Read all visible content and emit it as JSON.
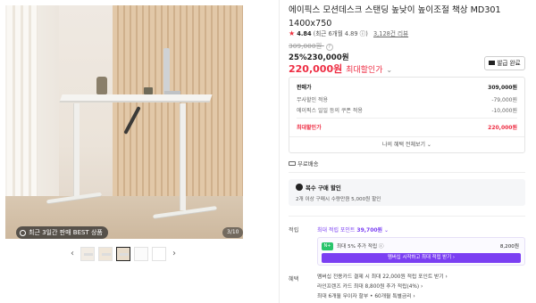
{
  "image": {
    "best_badge": "최근 3일간 판매 BEST 상품",
    "counter": "3/10",
    "prev_arrow": "‹",
    "next_arrow": "›",
    "thumbnail_count": 6,
    "selected_thumbnail": 3
  },
  "product": {
    "title": "에이픽스 모션데스크 스탠딩 높낮이 높이조절 책상 MD301 1400x750",
    "rating": {
      "star": "★",
      "score": "4.84",
      "count_text": "(최근 6개월 4.89 ⓘ)",
      "reviews": "3,128건 리뷰"
    },
    "original_price": "309,000원",
    "original_price_info": "?",
    "sale_price_line": "25%230,000원",
    "max_discount_price": "220,000원",
    "max_discount_label": "최대할인가",
    "max_discount_chevron": "⌄",
    "coupon_button": "발급 완료"
  },
  "price_box": {
    "rows": [
      {
        "label": "판매가",
        "value": "309,000원"
      },
      {
        "label": "무사할인 적용",
        "value": "-79,000원"
      },
      {
        "label": "에이픽스 일일 등의 쿠폰 적용",
        "value": "-10,000원"
      }
    ],
    "total_label": "최대할인가",
    "total_value": "220,000원",
    "all_benefits": "나의 혜택 전체보기 ⌄"
  },
  "shipping": {
    "label": "무료배송"
  },
  "multi_purchase": {
    "title": "복수 구매 할인",
    "desc": "2개 이상 구매시 수량만큼 5,000원 할인"
  },
  "earn": {
    "label": "적립",
    "max_prefix": "최대 적립 포인트",
    "max_value": "39,700원",
    "max_chevron": "⌄",
    "row_chip": "N+",
    "row_text": "최대 5% 추가 적립 ⓘ",
    "row_value": "8,200원",
    "join_button": "멤버십 시작하고 최대 적립 받기 ›"
  },
  "benefit": {
    "label": "혜택",
    "lines": [
      "멤버십 전용카드 결제 시 최대 22,000원 적립 포인트 받기 ›",
      "라인프렌즈 카드 최대 8,800원 추가 적립(4%) ›",
      "최대 6개월 무이자 할부 • 60개월 특별금리 ›"
    ]
  },
  "colors": {
    "accent_red": "#ee2d43",
    "membership_purple": "#7b3ff2",
    "naverpay_green": "#29c46b"
  }
}
